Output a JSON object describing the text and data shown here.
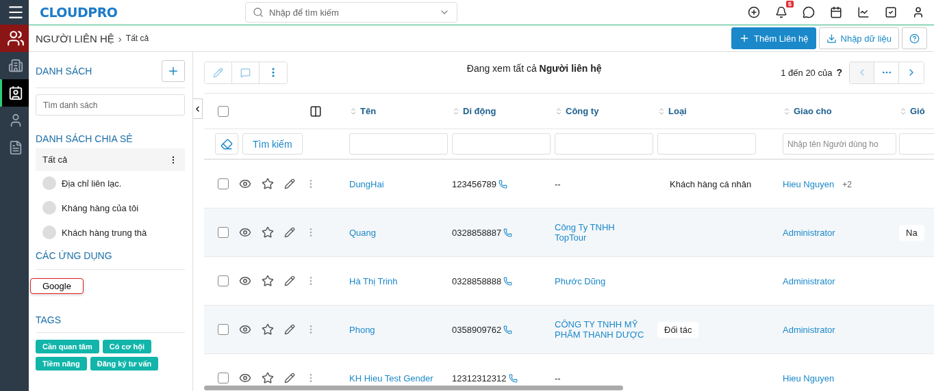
{
  "rail": [
    {
      "kind": "menu",
      "selected": false
    },
    {
      "kind": "group",
      "selected": false
    },
    {
      "kind": "building",
      "selected": false
    },
    {
      "kind": "contact",
      "selected": true
    },
    {
      "kind": "person",
      "selected": false
    },
    {
      "kind": "document",
      "selected": false
    }
  ],
  "logo": {
    "text": "CLOUDPRO"
  },
  "search": {
    "placeholder": "Nhập để tìm kiếm"
  },
  "notifications": {
    "count": "5"
  },
  "breadcrumb": {
    "module": "NGƯỜI LIÊN HỆ",
    "separator": "›",
    "current": "Tất cả"
  },
  "actions": {
    "add": "Thêm Liên hệ",
    "import": "Nhập dữ liệu"
  },
  "sidebar": {
    "lists_title": "DANH SÁCH",
    "list_search_placeholder": "Tìm danh sách",
    "shared_title": "DANH SÁCH CHIA SẺ",
    "shared_items": [
      {
        "label": "Tất cả",
        "selected": true
      },
      {
        "label": "Địa chỉ liên lạc.",
        "selected": false
      },
      {
        "label": "Kháng hàng của tôi",
        "selected": false
      },
      {
        "label": "Khách hàng trung thà",
        "selected": false
      }
    ],
    "apps_title": "CÁC ỨNG DỤNG",
    "apps": [
      {
        "label": "Google",
        "highlighted": true
      }
    ],
    "tags_title": "TAGS",
    "tags": [
      {
        "label": "Cần quan tâm"
      },
      {
        "label": "Có cơ hội"
      },
      {
        "label": "Tiềm năng"
      },
      {
        "label": "Đăng ký tư vấn"
      }
    ]
  },
  "toolbar": {
    "viewing": "Đang xem tất cả **Người liên hệ**",
    "pagination": "1 đến 20 của",
    "total": "?"
  },
  "table": {
    "search_button": "Tìm kiếm",
    "select_all": {
      "checked": false
    },
    "columns": [
      {
        "label": "Tên"
      },
      {
        "label": "Di động"
      },
      {
        "label": "Công ty"
      },
      {
        "label": "Loại"
      },
      {
        "label": "Giao cho",
        "placeholder": "Nhập tên Người dùng ho"
      },
      {
        "label": "Gió"
      }
    ],
    "rows": [
      {
        "checked": false,
        "name": "DungHai",
        "phone": "123456789",
        "company": {
          "text": "--",
          "kind": "plain"
        },
        "type": {
          "text": "Khách hàng cá nhân",
          "kind": "plain"
        },
        "assignee": "Hieu Nguyen",
        "assignee_more": "+2"
      },
      {
        "checked": false,
        "name": "Quang",
        "phone": "0328858887",
        "company": {
          "text": "Công Ty TNHH TopTour",
          "kind": "link"
        },
        "assignee": "Administrator",
        "column_6": "Na"
      },
      {
        "checked": false,
        "name": "Hà Thị Trinh",
        "phone": "0328858888",
        "company": {
          "text": "Phước Dũng",
          "kind": "link"
        },
        "assignee": "Administrator"
      },
      {
        "checked": false,
        "name": "Phong",
        "phone": "0358909762",
        "company": {
          "text": "CÔNG TY TNHH MỸ PHẨM THANH DƯỢC",
          "kind": "link"
        },
        "type": {
          "text": "Đối tác",
          "kind": "tag"
        },
        "assignee": "Administrator"
      },
      {
        "checked": false,
        "name": "KH Hieu Test Gender",
        "phone": "12312312312",
        "company": {
          "text": "--",
          "kind": "plain"
        },
        "assignee": "Hieu Nguyen"
      }
    ]
  }
}
